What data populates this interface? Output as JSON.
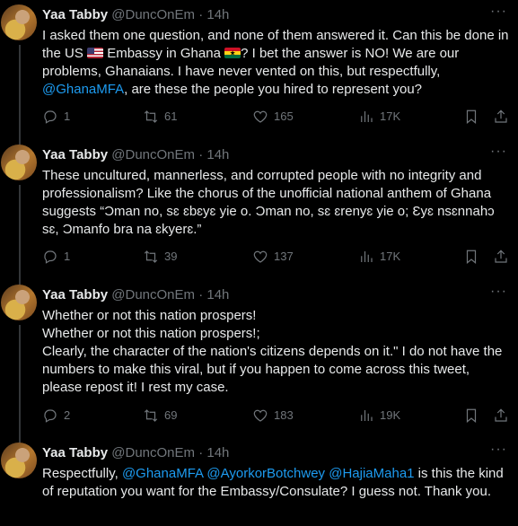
{
  "tweets": [
    {
      "name": "Yaa Tabby",
      "handle": "@DuncOnEm",
      "time": "· 14h",
      "text1": "I asked them one question, and none of them answered it. Can this be done in the US ",
      "text2": " Embassy in Ghana ",
      "text3": "? I bet the answer is NO! We are our problems, Ghanaians. I have never vented on this, but respectfully, ",
      "mention1": "@GhanaMFA",
      "text4": ", are these the people you hired to represent you?",
      "replies": "1",
      "retweets": "61",
      "likes": "165",
      "views": "17K"
    },
    {
      "name": "Yaa Tabby",
      "handle": "@DuncOnEm",
      "time": "· 14h",
      "text": "These uncultured, mannerless, and corrupted people with no integrity and professionalism? Like the chorus of the unofficial national anthem of Ghana suggests “Ɔman no, sɛ ɛbɛyɛ yie o. Ɔman no, sɛ ɛrenyɛ yie o; Ɛyɛ nsɛnnahɔ sɛ, Ɔmanfo bra na ɛkyerɛ.”",
      "replies": "1",
      "retweets": "39",
      "likes": "137",
      "views": "17K"
    },
    {
      "name": "Yaa Tabby",
      "handle": "@DuncOnEm",
      "time": "· 14h",
      "line1": "Whether or not this nation prospers!",
      "line2": "Whether or not this nation prospers!;",
      "line3": "Clearly, the character of the nation's citizens depends on it.\" I do not have the numbers to make this viral, but if you happen to come across this tweet, please repost it! I rest my case.",
      "replies": "2",
      "retweets": "69",
      "likes": "183",
      "views": "19K"
    },
    {
      "name": "Yaa Tabby",
      "handle": "@DuncOnEm",
      "time": "· 14h",
      "text1": "Respectfully, ",
      "mention1": "@GhanaMFA",
      "mention2": "@AyorkorBotchwey",
      "mention3": "@HajiaMaha1",
      "text2": " is this the kind of reputation you want for the Embassy/Consulate? I guess not. Thank you."
    }
  ],
  "more_label": "···",
  "icons": [
    "reply-icon",
    "retweet-icon",
    "like-icon",
    "views-icon",
    "bookmark-icon",
    "share-icon",
    "more-icon",
    "flag-us-icon",
    "flag-ghana-icon"
  ],
  "colors": {
    "background": "#000000",
    "text": "#e7e9ea",
    "muted": "#71767b",
    "link": "#1d9bf0",
    "thread": "#333639"
  }
}
